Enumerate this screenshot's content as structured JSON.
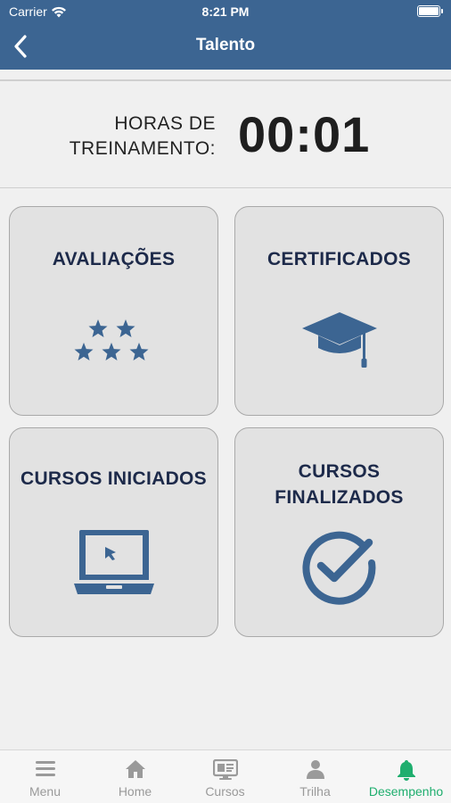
{
  "status_bar": {
    "carrier": "Carrier",
    "time": "8:21 PM"
  },
  "nav": {
    "title": "Talento"
  },
  "training": {
    "label_line1": "HORAS DE",
    "label_line2": "TREINAMENTO:",
    "value": "00:01"
  },
  "cards": {
    "avaliacoes": {
      "label": "AVALIAÇÕES",
      "icon": "stars-icon"
    },
    "certificados": {
      "label": "CERTIFICADOS",
      "icon": "graduation-cap-icon"
    },
    "cursos_iniciados": {
      "label": "CURSOS INICIADOS",
      "icon": "laptop-icon"
    },
    "cursos_finalizados": {
      "label_line1": "CURSOS",
      "label_line2": "FINALIZADOS",
      "icon": "check-circle-icon"
    }
  },
  "tabs": [
    {
      "label": "Menu",
      "icon": "menu-icon"
    },
    {
      "label": "Home",
      "icon": "home-icon"
    },
    {
      "label": "Cursos",
      "icon": "monitor-icon"
    },
    {
      "label": "Trilha",
      "icon": "person-icon"
    },
    {
      "label": "Desempenho",
      "icon": "bell-icon"
    }
  ],
  "colors": {
    "primary": "#3c6592",
    "card_text": "#1d2a4a",
    "active_tab": "#1fae6e",
    "inactive_tab": "#9a9a9a"
  }
}
